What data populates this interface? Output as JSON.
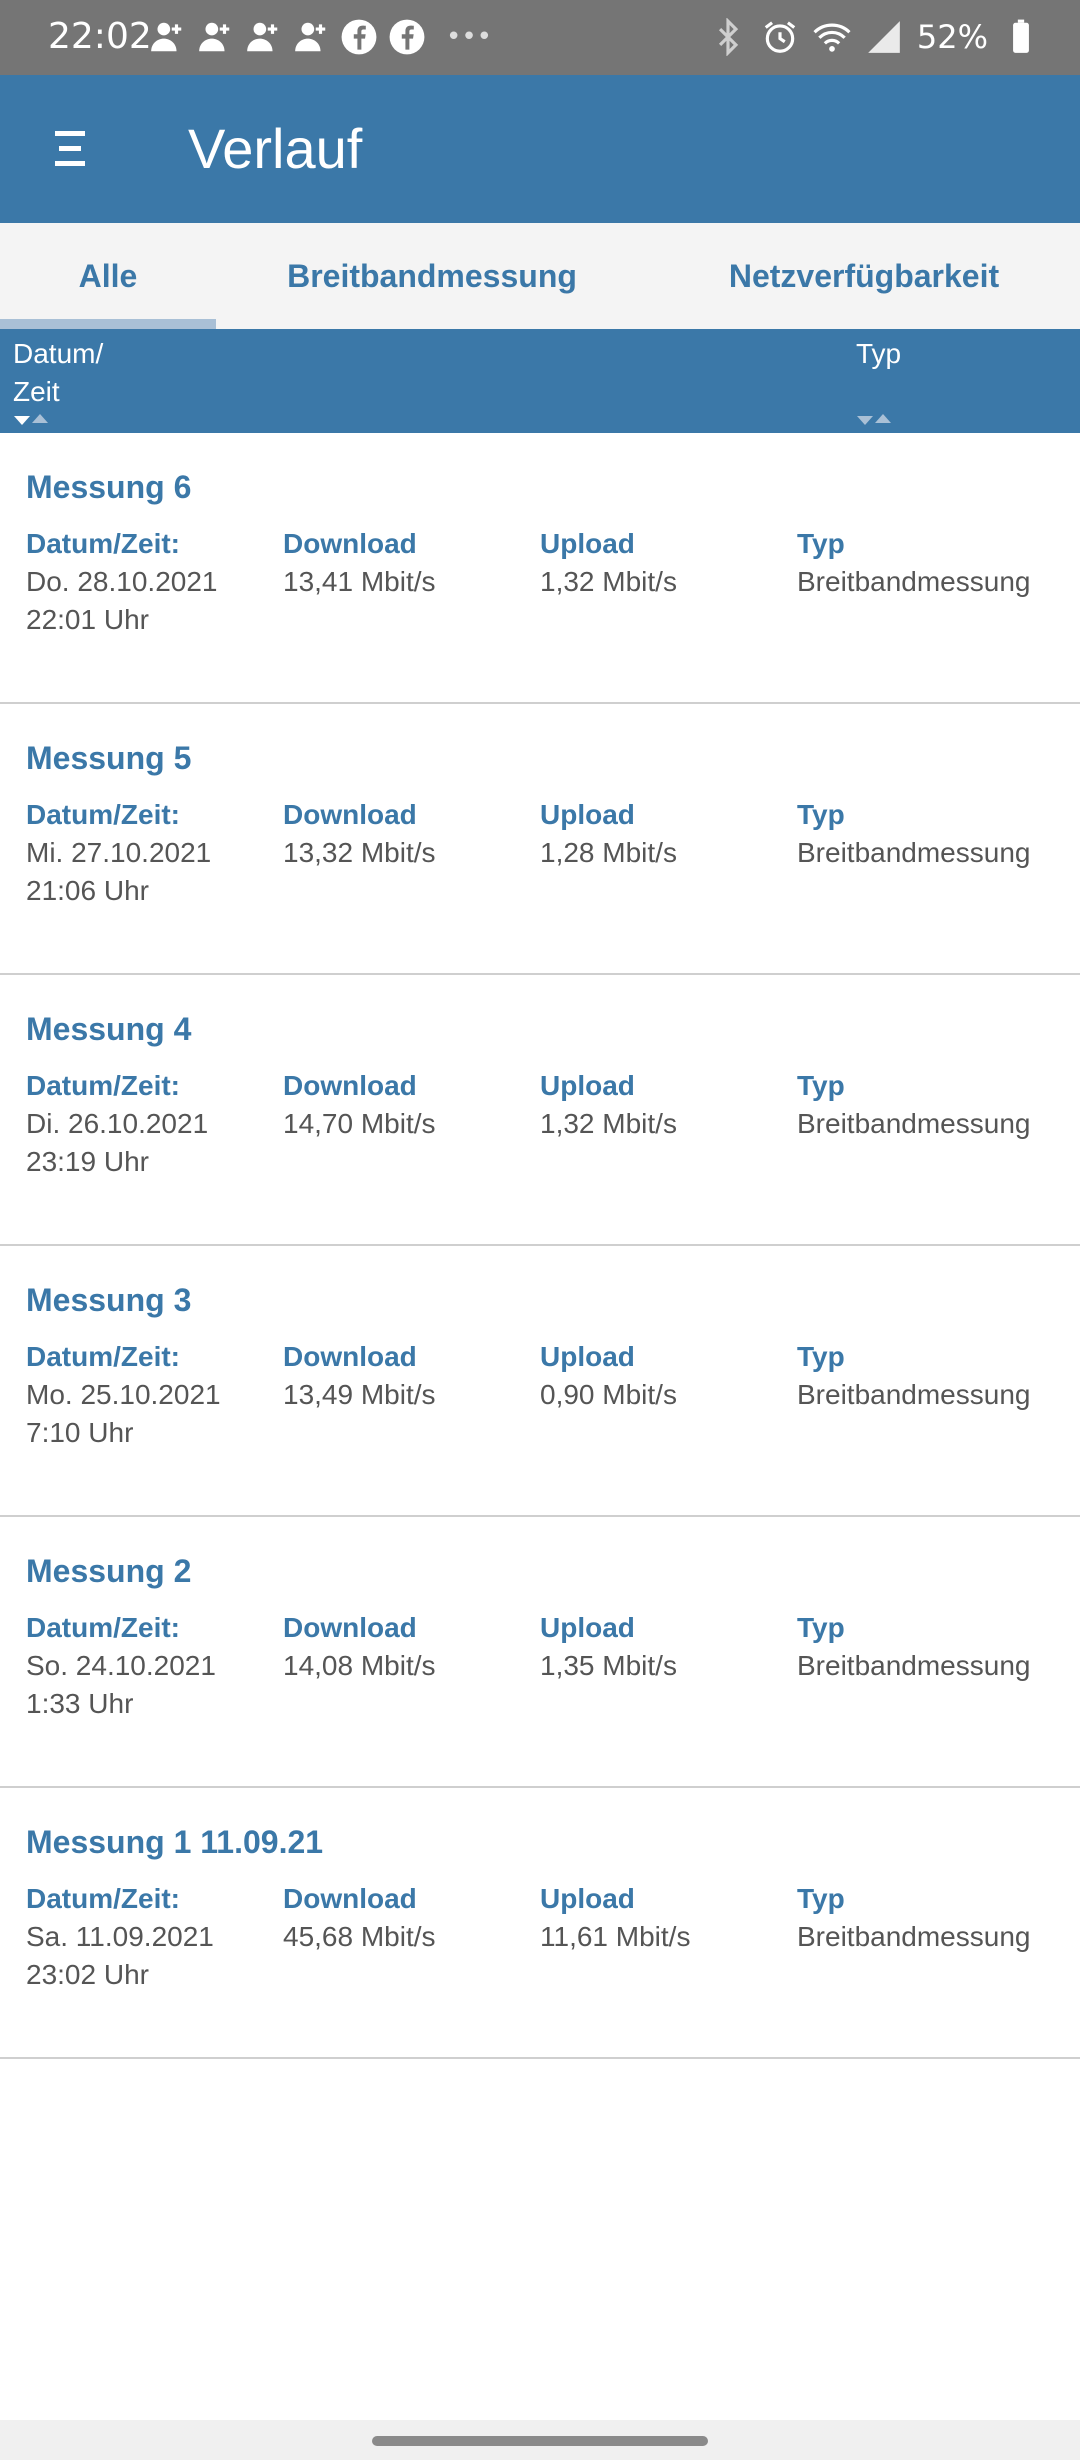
{
  "status_bar": {
    "time": "22:02",
    "battery": "52%",
    "left_icons": [
      "person-add-icon",
      "person-add-icon",
      "person-add-icon",
      "person-add-icon",
      "facebook-icon",
      "facebook-icon",
      "more-icon"
    ],
    "right_icons": [
      "bluetooth-icon",
      "alarm-icon",
      "wifi-icon",
      "signal-icon",
      "battery-icon"
    ]
  },
  "appbar": {
    "title": "Verlauf",
    "menu_icon": "hamburger-menu-icon"
  },
  "tabs": [
    {
      "label": "Alle",
      "active": true
    },
    {
      "label": "Breitbandmessung",
      "active": false
    },
    {
      "label": "Netzverfügbarkeit",
      "active": false
    }
  ],
  "table_header": {
    "date_line1": "Datum/",
    "date_line2": "Zeit",
    "type": "Typ"
  },
  "labels": {
    "date": "Datum/Zeit:",
    "download": "Download",
    "upload": "Upload",
    "type": "Typ"
  },
  "rows": [
    {
      "title": "Messung 6",
      "date": "Do. 28.10.2021",
      "time": "22:01 Uhr",
      "download": "13,41 Mbit/s",
      "upload": "1,32 Mbit/s",
      "type": "Breitbandmessung"
    },
    {
      "title": "Messung 5",
      "date": "Mi. 27.10.2021",
      "time": "21:06 Uhr",
      "download": "13,32 Mbit/s",
      "upload": "1,28 Mbit/s",
      "type": "Breitbandmessung"
    },
    {
      "title": "Messung 4",
      "date": "Di. 26.10.2021",
      "time": "23:19 Uhr",
      "download": "14,70 Mbit/s",
      "upload": "1,32 Mbit/s",
      "type": "Breitbandmessung"
    },
    {
      "title": "Messung 3",
      "date": "Mo. 25.10.2021",
      "time": "7:10 Uhr",
      "download": "13,49 Mbit/s",
      "upload": "0,90 Mbit/s",
      "type": "Breitbandmessung"
    },
    {
      "title": "Messung 2",
      "date": "So. 24.10.2021",
      "time": "1:33 Uhr",
      "download": "14,08 Mbit/s",
      "upload": "1,35 Mbit/s",
      "type": "Breitbandmessung"
    },
    {
      "title": "Messung 1 11.09.21",
      "date": "Sa. 11.09.2021",
      "time": "23:02 Uhr",
      "download": "45,68 Mbit/s",
      "upload": "11,61 Mbit/s",
      "type": "Breitbandmessung"
    }
  ]
}
